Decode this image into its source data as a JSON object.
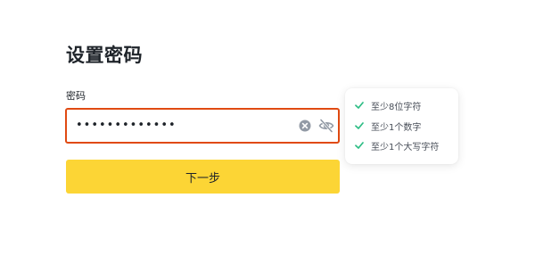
{
  "page": {
    "title": "设置密码"
  },
  "password_field": {
    "label": "密码",
    "value": "•••••••••••••",
    "clear_icon": "clear-circle-icon",
    "toggle_icon": "eye-slash-icon"
  },
  "next_button": {
    "label": "下一步"
  },
  "requirements": {
    "items": [
      {
        "label": "至少8位字符",
        "met": true
      },
      {
        "label": "至少1个数字",
        "met": true
      },
      {
        "label": "至少1个大写字符",
        "met": true
      }
    ]
  },
  "colors": {
    "accent_yellow": "#fcd535",
    "error_border": "#e04a12",
    "check_green": "#2ebd85"
  }
}
